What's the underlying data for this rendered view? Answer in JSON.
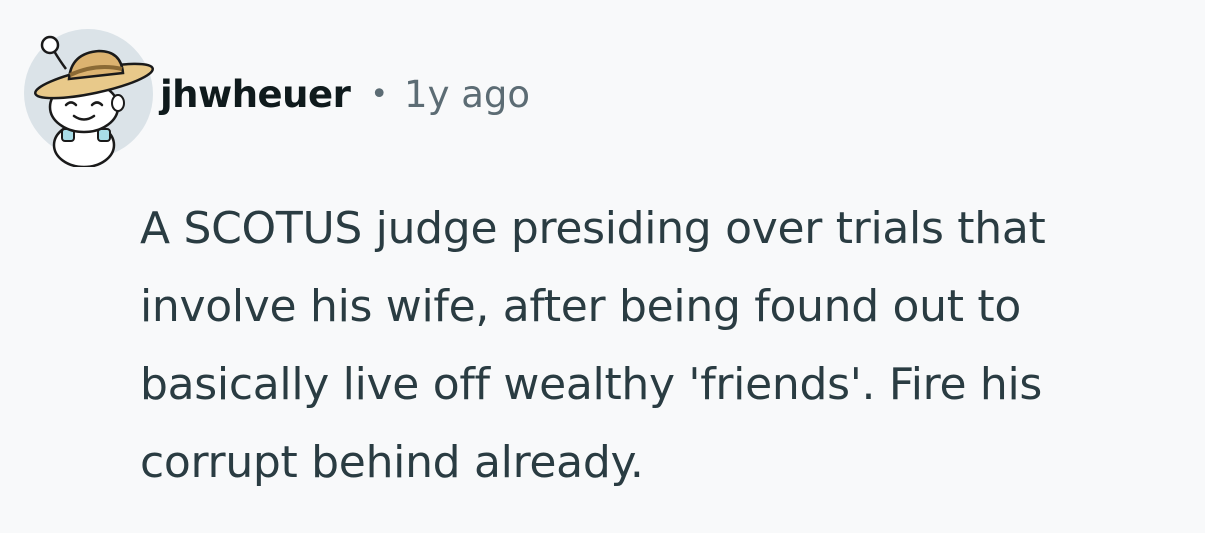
{
  "comment": {
    "author": {
      "username": "jhwheuer",
      "avatar_icon": "snoo-avatar-with-straw-hat-icon"
    },
    "separator": "•",
    "timestamp": "1y ago",
    "body": "A SCOTUS judge presiding over trials that involve his wife, after being found out to basically live off wealthy 'friends'. Fire his corrupt behind already."
  },
  "colors": {
    "background": "#f8f9fa",
    "username": "#0f1a1c",
    "meta": "#5c6c74",
    "body": "#2a3c42",
    "avatar_bg": "#dbe3e8"
  }
}
